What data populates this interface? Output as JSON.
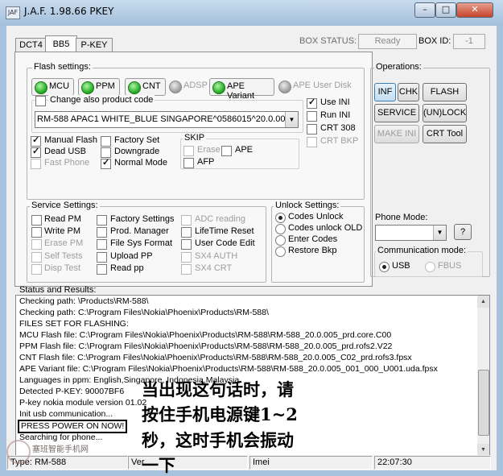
{
  "window": {
    "title": "J.A.F.  1.98.66 PKEY",
    "icon_text": "JAF",
    "controls": {
      "minimize": "–",
      "maximize": "□",
      "close": "✕"
    }
  },
  "tabs": [
    {
      "label": "DCT4"
    },
    {
      "label": "BB5"
    },
    {
      "label": "P-KEY"
    }
  ],
  "header": {
    "box_status_label": "BOX STATUS:",
    "box_status_value": "Ready",
    "box_id_label": "BOX ID:",
    "box_id_value": "-1"
  },
  "flash_settings": {
    "title": "Flash settings:",
    "leds": [
      {
        "label": "MCU",
        "on": true
      },
      {
        "label": "PPM",
        "on": true
      },
      {
        "label": "CNT",
        "on": true
      },
      {
        "label": "ADSP",
        "on": false
      },
      {
        "label": "APE Variant",
        "on": true
      },
      {
        "label": "APE User Disk",
        "on": false
      }
    ],
    "change_product_code_label": "Change also product code",
    "product_code_value": "RM-588 APAC1 WHITE_BLUE SINGAPORE^0586015^20.0.005",
    "right_checks": [
      {
        "label": "Use INI",
        "checked": true,
        "enabled": true
      },
      {
        "label": "Run INI",
        "checked": false,
        "enabled": true
      },
      {
        "label": "CRT 308",
        "checked": false,
        "enabled": true
      },
      {
        "label": "CRT BKP",
        "checked": false,
        "enabled": false
      }
    ],
    "left_checks": [
      {
        "label": "Manual Flash",
        "checked": true,
        "enabled": true
      },
      {
        "label": "Dead USB",
        "checked": true,
        "enabled": true
      },
      {
        "label": "Fast Phone",
        "checked": false,
        "enabled": false
      }
    ],
    "mid_checks": [
      {
        "label": "Factory Set",
        "checked": false,
        "enabled": true
      },
      {
        "label": "Downgrade",
        "checked": false,
        "enabled": true
      },
      {
        "label": "Normal Mode",
        "checked": true,
        "enabled": true
      }
    ],
    "skip": {
      "title": "SKIP",
      "checks": [
        {
          "label": "Erase",
          "checked": false,
          "enabled": false
        },
        {
          "label": "APE",
          "checked": false,
          "enabled": true
        },
        {
          "label": "AFP",
          "checked": false,
          "enabled": true
        }
      ]
    }
  },
  "service_settings": {
    "title": "Service Settings:",
    "col1": [
      {
        "label": "Read PM",
        "enabled": true
      },
      {
        "label": "Write PM",
        "enabled": true
      },
      {
        "label": "Erase PM",
        "enabled": false
      },
      {
        "label": "Self Tests",
        "enabled": false
      },
      {
        "label": "Disp Test",
        "enabled": false
      }
    ],
    "col2": [
      {
        "label": "Factory Settings",
        "enabled": true
      },
      {
        "label": "Prod. Manager",
        "enabled": true
      },
      {
        "label": "File Sys Format",
        "enabled": true
      },
      {
        "label": "Upload PP",
        "enabled": true
      },
      {
        "label": "Read pp",
        "enabled": true
      }
    ],
    "col3": [
      {
        "label": "ADC reading",
        "enabled": false
      },
      {
        "label": "LifeTime Reset",
        "enabled": true
      },
      {
        "label": "User Code Edit",
        "enabled": true
      },
      {
        "label": "SX4 AUTH",
        "enabled": false
      },
      {
        "label": "SX4 CRT",
        "enabled": false
      }
    ]
  },
  "unlock_settings": {
    "title": "Unlock Settings:",
    "options": [
      {
        "label": "Codes Unlock",
        "selected": true
      },
      {
        "label": "Codes unlock OLD",
        "selected": false
      },
      {
        "label": "Enter Codes",
        "selected": false
      },
      {
        "label": "Restore Bkp",
        "selected": false
      }
    ]
  },
  "operations": {
    "title": "Operations:",
    "buttons": [
      {
        "label": "INF",
        "enabled": true
      },
      {
        "label": "CHK",
        "enabled": true
      },
      {
        "label": "FLASH",
        "enabled": true
      },
      {
        "label": "SERVICE",
        "enabled": true
      },
      {
        "label": "(UN)LOCK",
        "enabled": true
      },
      {
        "label": "MAKE INI",
        "enabled": false
      },
      {
        "label": "CRT Tool",
        "enabled": true
      }
    ]
  },
  "phone_mode": {
    "title": "Phone Mode:",
    "value": "",
    "help_label": "?"
  },
  "communication_mode": {
    "title": "Communication mode:",
    "options": [
      {
        "label": "USB",
        "selected": true,
        "enabled": true
      },
      {
        "label": "FBUS",
        "selected": false,
        "enabled": false
      }
    ]
  },
  "status": {
    "title": "Status and Results:",
    "lines": [
      "Checking path: \\Products\\RM-588\\",
      "Checking path: C:\\Program Files\\Nokia\\Phoenix\\Products\\RM-588\\",
      "FILES SET FOR FLASHING:",
      "MCU Flash file: C:\\Program Files\\Nokia\\Phoenix\\Products\\RM-588\\RM-588_20.0.005_prd.core.C00",
      "PPM Flash file: C:\\Program Files\\Nokia\\Phoenix\\Products\\RM-588\\RM-588_20.0.005_prd.rofs2.V22",
      "CNT Flash file: C:\\Program Files\\Nokia\\Phoenix\\Products\\RM-588\\RM-588_20.0.005_C02_prd.rofs3.fpsx",
      "APE Variant file: C:\\Program Files\\Nokia\\Phoenix\\Products\\RM-588\\RM-588_20.0.005_001_000_U001.uda.fpsx",
      "Languages in ppm: English,Singapore, Indonesia,Malaysia",
      "Detected P-KEY: 90007BF6",
      "P-key nokia module version 01.02",
      "Init usb communication...",
      "PRESS POWER ON NOW!",
      "Searching for phone..."
    ],
    "highlight_index": 11
  },
  "statusbar": {
    "type": "Type: RM-588",
    "ver": "Ver",
    "imei": "Imei",
    "time": "22:07:30"
  },
  "overlay": {
    "lines": [
      "当出现这句话时，请",
      "按住手机电源键1~2",
      "秒，这时手机会振动",
      "一下"
    ]
  },
  "watermark": {
    "text": "塞班智能手机网"
  },
  "colors": {
    "titlebar": "#a6c2dd",
    "led_on": "#1ea51e",
    "highlight_box": "#000000"
  }
}
